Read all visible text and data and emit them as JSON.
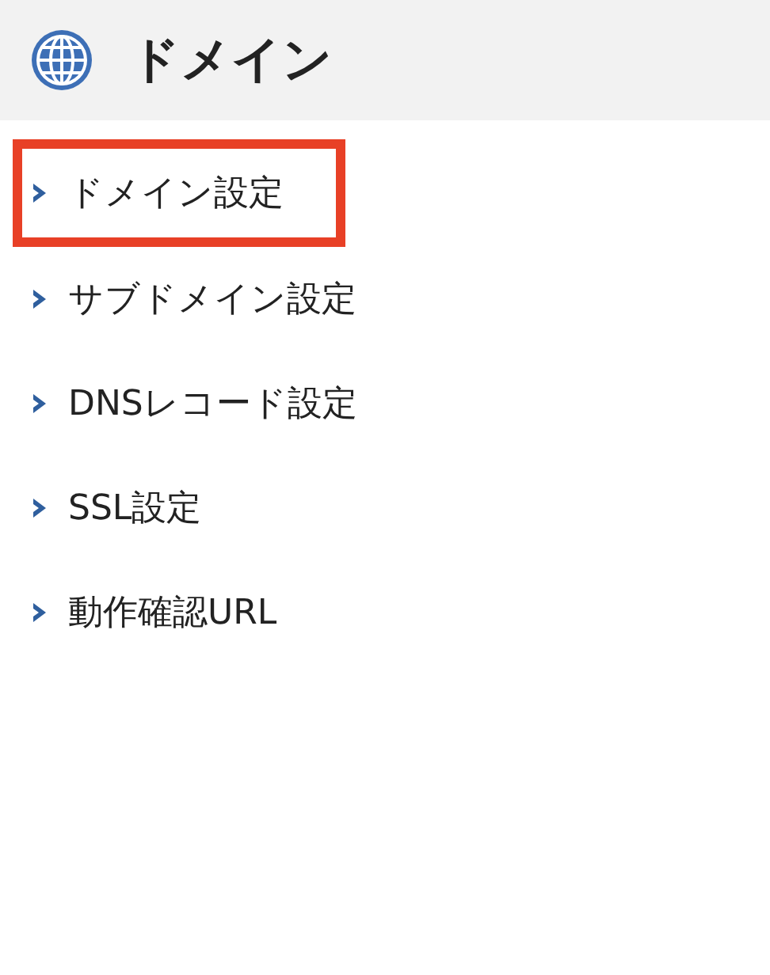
{
  "header": {
    "title": "ドメイン"
  },
  "menu": {
    "items": [
      {
        "label": "ドメイン設定",
        "highlighted": true
      },
      {
        "label": "サブドメイン設定",
        "highlighted": false
      },
      {
        "label": "DNSレコード設定",
        "highlighted": false
      },
      {
        "label": "SSL設定",
        "highlighted": false
      },
      {
        "label": "動作確認URL",
        "highlighted": false
      }
    ]
  }
}
